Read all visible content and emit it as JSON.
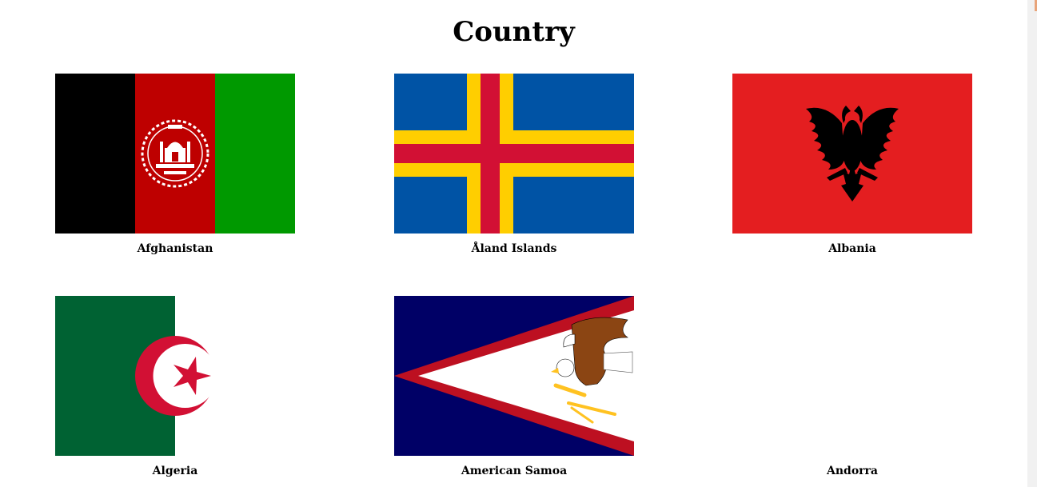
{
  "page": {
    "title": "Country"
  },
  "countries": [
    {
      "name": "Afghanistan",
      "flag_icon": "afghanistan-flag",
      "colors": [
        "#000000",
        "#be0000",
        "#009900"
      ]
    },
    {
      "name": "Åland Islands",
      "flag_icon": "aland-islands-flag",
      "colors": [
        "#0053a5",
        "#ffce00",
        "#d21034"
      ]
    },
    {
      "name": "Albania",
      "flag_icon": "albania-flag",
      "colors": [
        "#e41e20",
        "#000000"
      ]
    },
    {
      "name": "Algeria",
      "flag_icon": "algeria-flag",
      "colors": [
        "#006233",
        "#ffffff",
        "#d21034"
      ]
    },
    {
      "name": "American Samoa",
      "flag_icon": "american-samoa-flag",
      "colors": [
        "#000066",
        "#bd1021",
        "#ffffff",
        "#ffc221"
      ]
    },
    {
      "name": "Andorra",
      "flag_icon": "andorra-flag",
      "colors": []
    }
  ]
}
